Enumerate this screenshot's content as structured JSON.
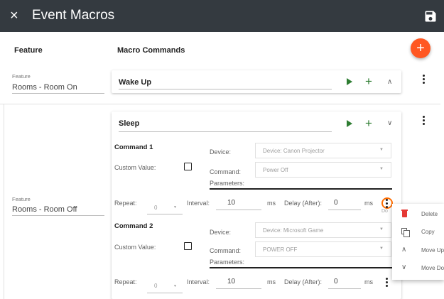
{
  "appbar": {
    "title": "Event Macros",
    "close_icon": "×"
  },
  "columns": {
    "feature": "Feature",
    "macro_commands": "Macro Commands"
  },
  "fab": {
    "label": "+"
  },
  "rows": [
    {
      "feature_label": "Feature",
      "feature_value": "Rooms - Room On",
      "macro_name": "Wake Up",
      "expanded": false
    },
    {
      "feature_label": "Feature",
      "feature_value": "Rooms - Room Off",
      "macro_name": "Sleep",
      "expanded": true
    }
  ],
  "commands": [
    {
      "title": "Command 1",
      "custom_value_label": "Custom Value:",
      "custom_value_checked": false,
      "device_label": "Device:",
      "device_value": "Device: Canon Projector",
      "command_label": "Command:",
      "command_value": "Power Off",
      "parameters_label": "Parameters:",
      "repeat_label": "Repeat:",
      "repeat_value": "0",
      "interval_label": "Interval:",
      "interval_value": "10",
      "interval_unit": "ms",
      "delay_label": "Delay (After):",
      "delay_value": "0",
      "delay_unit": "ms"
    },
    {
      "title": "Command 2",
      "custom_value_label": "Custom Value:",
      "custom_value_checked": false,
      "device_label": "Device:",
      "device_value": "Device: Microsoft Game",
      "command_label": "Command:",
      "command_value": "POWER OFF",
      "parameters_label": "Parameters:",
      "repeat_label": "Repeat:",
      "repeat_value": "0",
      "interval_label": "Interval:",
      "interval_value": "10",
      "interval_unit": "ms",
      "delay_label": "Delay (After):",
      "delay_value": "0",
      "delay_unit": "ms"
    }
  ],
  "context_menu": {
    "partial_label": "Do",
    "items": [
      {
        "label": "Delete",
        "icon": "trash-icon"
      },
      {
        "label": "Copy",
        "icon": "copy-icon"
      },
      {
        "label": "Move Up",
        "icon": "chevron-up-icon"
      },
      {
        "label": "Move Do",
        "icon": "chevron-down-icon"
      }
    ]
  },
  "colors": {
    "appbar": "#343a40",
    "accent": "#ff5722",
    "play_green": "#2e7d32",
    "delete_red": "#e53935"
  }
}
